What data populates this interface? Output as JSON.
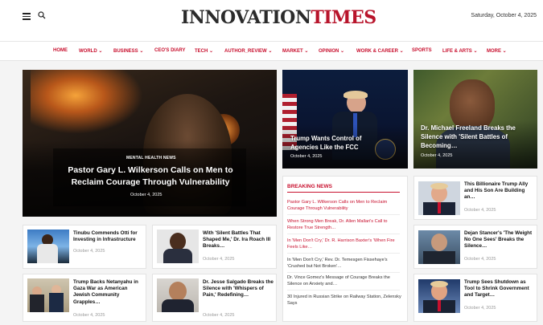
{
  "header": {
    "logo_part1": "INNOVATION",
    "logo_part2": "TIMES",
    "date": "Saturday, October 4, 2025",
    "menu_icon": "hamburger-icon",
    "search_icon": "search-icon"
  },
  "nav": {
    "items": [
      {
        "label": "HOME"
      },
      {
        "label": "WORLD ⌄"
      },
      {
        "label": "BUSINESS ⌄"
      },
      {
        "label": "CEO'S DIARY"
      },
      {
        "label": "TECH ⌄"
      },
      {
        "label": "AUTHOR_REVIEW ⌄"
      },
      {
        "label": "MARKET ⌄"
      },
      {
        "label": "OPINION ⌄"
      },
      {
        "label": "WORK & CAREER ⌄"
      },
      {
        "label": "SPORTS"
      },
      {
        "label": "LIFE & ARTS ⌄"
      },
      {
        "label": "MORE ⌄"
      }
    ]
  },
  "hero": {
    "category": "MENTAL HEALTH NEWS",
    "title": "Pastor Gary L. Wilkerson Calls on Men to Reclaim Courage Through Vulnerability",
    "date": "October 4, 2025"
  },
  "feature_mid": {
    "title": "Trump Wants Control of Agencies Like the FCC",
    "date": "October 4, 2025"
  },
  "feature_right": {
    "title": "Dr. Michael Freeland Breaks the Silence with 'Silent Battles of Becoming…",
    "date": "October 4, 2025"
  },
  "small_cards": [
    {
      "title": "Tinubu Commends Otti for Investing in Infrastructure",
      "date": "October 4, 2025"
    },
    {
      "title": "With 'Silent Battles That Shaped Me,' Dr. Ira Roach III Breaks…",
      "date": "October 4, 2025"
    },
    {
      "title": "Trump Backs Netanyahu in Gaza War as American Jewish Community Grapples…",
      "date": "October 4, 2025"
    },
    {
      "title": "Dr. Jesse Salgado Breaks the Silence with 'Whispers of Pain,' Redefining…",
      "date": "October 4, 2025"
    }
  ],
  "breaking": {
    "heading": "BREAKING NEWS",
    "items": [
      {
        "text": "Pastor Gary L. Wilkerson Calls on Men to Reclaim Courage Through Vulnerability"
      },
      {
        "text": "When Strong Men Break, Dr. Allen Mallari's Call to Restore True Strength…"
      },
      {
        "text": "In 'Men Don't Cry,' Dr. R. Harrison Baxter's 'When Fire Feels Like…"
      },
      {
        "text": "In 'Men Don't Cry,' Rev. Dr. Temesgen Fissehaye's 'Crushed but Not Broken'…"
      },
      {
        "text": "Dr. Vince Gomez's Message of Courage Breaks the Silence on Anxiety and…"
      },
      {
        "text": "30 Injured in Russian Strike on Railway Station, Zelensky Says"
      }
    ]
  },
  "right_list": [
    {
      "title": "This Billionaire Trump Ally and His Son Are Building an…",
      "date": "October 4, 2025"
    },
    {
      "title": "Dejan Stancer's 'The Weight No One Sees' Breaks the Silence…",
      "date": "October 4, 2025"
    },
    {
      "title": "Trump Sees Shutdown as Tool to Shrink Government and Target…",
      "date": "October 4, 2025"
    }
  ],
  "colors": {
    "accent": "#c8102e",
    "logo_dark": "#2b2b2b"
  }
}
